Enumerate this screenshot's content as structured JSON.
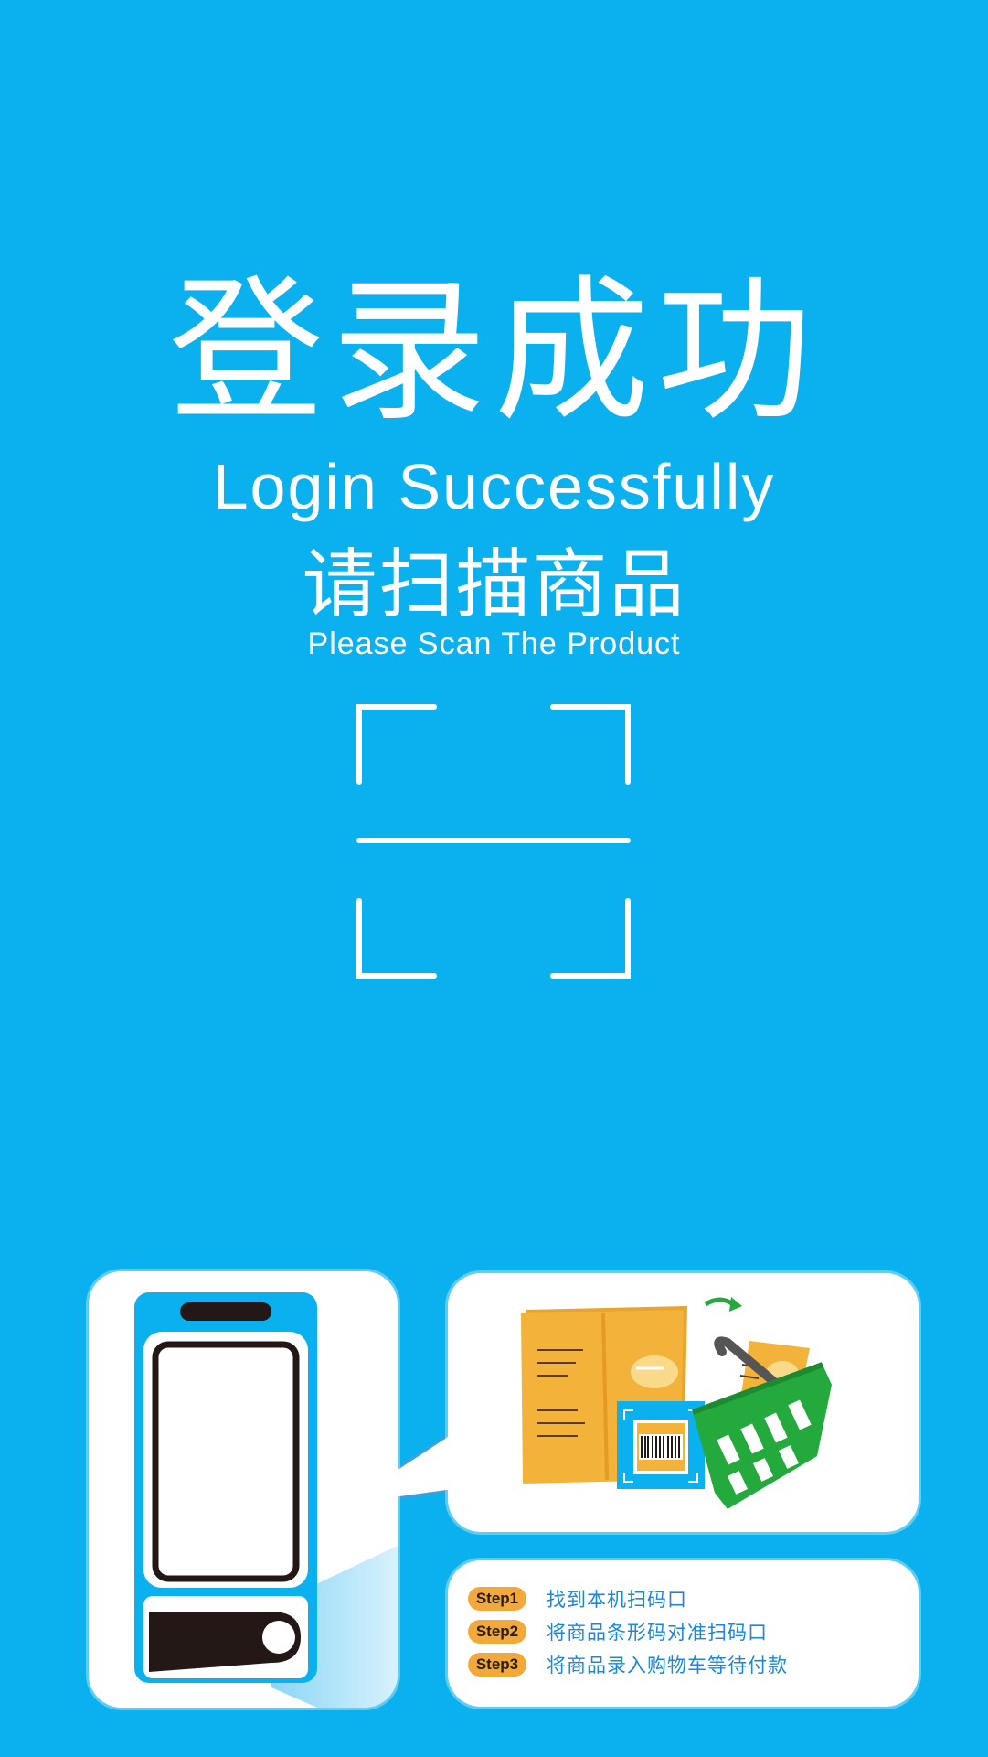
{
  "header": {
    "title_cn": "登录成功",
    "title_en": "Login Successfully",
    "subtitle_cn": "请扫描商品",
    "subtitle_en": "Please Scan The Product"
  },
  "colors": {
    "background": "#0AB1EE",
    "white": "#FFFFFF",
    "step_badge": "#F3A93A",
    "step_text": "#1E86D9",
    "device_body": "#0AB1EE",
    "basket": "#23A93C",
    "bag": "#F3B239"
  },
  "illustration": {
    "device_icon": "kiosk-device-icon",
    "scanner_icon": "scanner-beam-icon",
    "product_icon": "product-bag-icon",
    "barcode_icon": "barcode-icon",
    "basket_icon": "shopping-basket-icon",
    "arrow_icon": "curved-arrow-icon"
  },
  "steps": [
    {
      "badge": "Step1",
      "text": "找到本机扫码口"
    },
    {
      "badge": "Step2",
      "text": "将商品条形码对准扫码口"
    },
    {
      "badge": "Step3",
      "text": "将商品录入购物车等待付款"
    }
  ]
}
